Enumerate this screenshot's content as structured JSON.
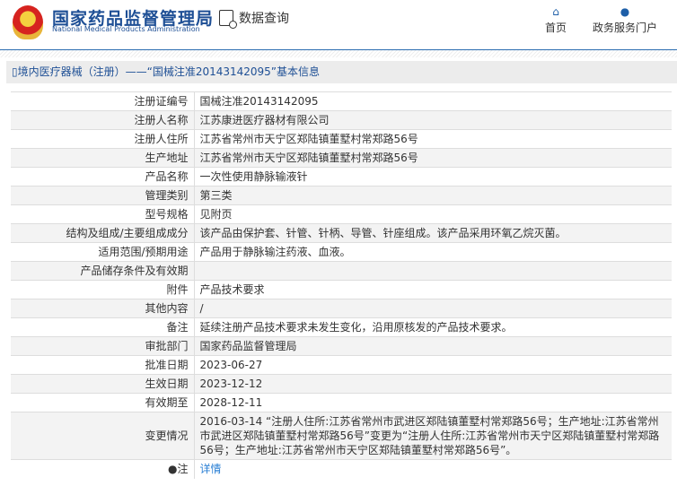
{
  "header": {
    "brand_cn": "国家药品监督管理局",
    "brand_en": "National Medical Products Administration",
    "query": "数据查询",
    "nav": [
      {
        "label": "首页",
        "icon": "home-icon"
      },
      {
        "label": "政务服务门户",
        "icon": "user-icon"
      }
    ]
  },
  "title": "境内医疗器械（注册）——“国械注准20143142095”基本信息",
  "rows": [
    {
      "label": "注册证编号",
      "value": "国械注准20143142095"
    },
    {
      "label": "注册人名称",
      "value": "江苏康进医疗器材有限公司"
    },
    {
      "label": "注册人住所",
      "value": "江苏省常州市天宁区郑陆镇董墅村常郑路56号"
    },
    {
      "label": "生产地址",
      "value": "江苏省常州市天宁区郑陆镇董墅村常郑路56号"
    },
    {
      "label": "产品名称",
      "value": "一次性使用静脉输液针"
    },
    {
      "label": "管理类别",
      "value": "第三类"
    },
    {
      "label": "型号规格",
      "value": "见附页"
    },
    {
      "label": "结构及组成/主要组成成分",
      "value": "该产品由保护套、针管、针柄、导管、针座组成。该产品采用环氧乙烷灭菌。"
    },
    {
      "label": "适用范围/预期用途",
      "value": "产品用于静脉输注药液、血液。"
    },
    {
      "label": "产品储存条件及有效期",
      "value": ""
    },
    {
      "label": "附件",
      "value": "产品技术要求"
    },
    {
      "label": "其他内容",
      "value": "/"
    },
    {
      "label": "备注",
      "value": "延续注册产品技术要求未发生变化，沿用原核发的产品技术要求。"
    },
    {
      "label": "审批部门",
      "value": "国家药品监督管理局"
    },
    {
      "label": "批准日期",
      "value": "2023-06-27"
    },
    {
      "label": "生效日期",
      "value": "2023-12-12"
    },
    {
      "label": "有效期至",
      "value": "2028-12-11"
    },
    {
      "label": "变更情况",
      "value": "2016-03-14 “注册人住所:江苏省常州市武进区郑陆镇董墅村常郑路56号；生产地址:江苏省常州市武进区郑陆镇董墅村常郑路56号”变更为“注册人住所:江苏省常州市天宁区郑陆镇董墅村常郑路56号；生产地址:江苏省常州市天宁区郑陆镇董墅村常郑路56号”。"
    }
  ],
  "note": {
    "label": "注",
    "link": "详情"
  }
}
